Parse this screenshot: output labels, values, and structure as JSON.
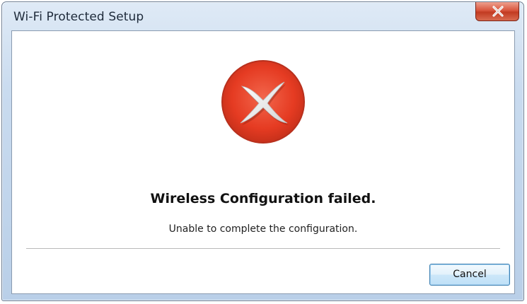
{
  "window": {
    "title": "Wi-Fi Protected Setup"
  },
  "titlebar": {
    "close_icon": "close-x-icon"
  },
  "dialog": {
    "status_icon": "error-x-icon",
    "headline": "Wireless Configuration failed.",
    "message": "Unable to complete the configuration."
  },
  "buttons": {
    "cancel_label": "Cancel"
  },
  "colors": {
    "error_red": "#e53b22",
    "close_red": "#c94a33",
    "button_border": "#3c7fb1",
    "titlebar_blue": "#c9dbef"
  }
}
